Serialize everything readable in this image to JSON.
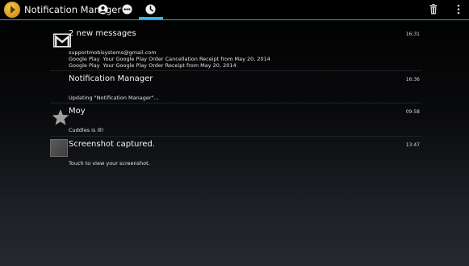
{
  "app": {
    "title": "Notification Manager",
    "tabs": [
      {
        "icon": "person-icon",
        "selected": false
      },
      {
        "icon": "more-icon",
        "selected": false
      },
      {
        "icon": "clock-icon",
        "selected": true
      }
    ],
    "actions": [
      {
        "icon": "trash-icon"
      },
      {
        "icon": "overflow-menu-icon"
      }
    ],
    "accent_color": "#33b5e5"
  },
  "notifications": [
    {
      "icon": "gmail-icon",
      "title": "2 new messages",
      "time": "16:31",
      "lines": [
        {
          "text": "supportmobisystems@gmail.com"
        },
        {
          "app": "Google Play",
          "text": "Your Google Play Order Cancellation Receipt from May 20, 2014"
        },
        {
          "app": "Google Play",
          "text": "Your Google Play Order Receipt from May 20, 2014"
        }
      ]
    },
    {
      "icon": "",
      "title": "Notification Manager",
      "time": "16:36",
      "lines": [
        {
          "text": "Updating \"Notification Manager\"..."
        }
      ]
    },
    {
      "icon": "star-icon",
      "title": "Moy",
      "time": "09:58",
      "lines": [
        {
          "text": "Cuddles is ill!"
        }
      ]
    },
    {
      "icon": "screenshot-thumbnail",
      "title": "Screenshot captured.",
      "time": "13:47",
      "lines": [
        {
          "text": "Touch to view your screenshot."
        }
      ]
    }
  ]
}
